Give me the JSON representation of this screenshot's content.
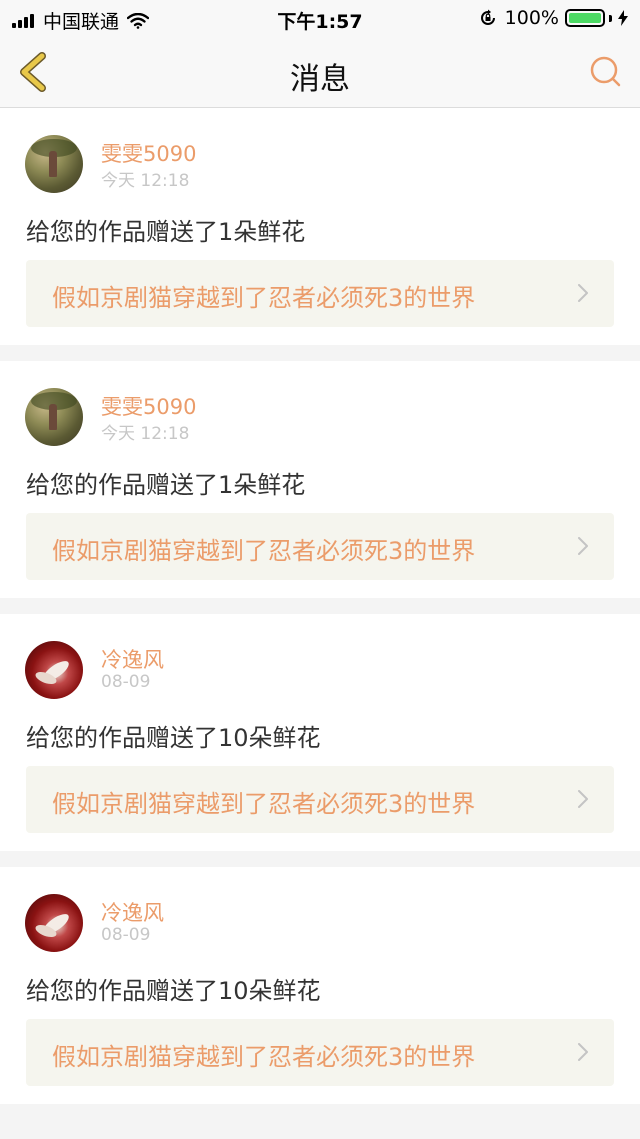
{
  "status_bar": {
    "carrier": "中国联通",
    "time": "下午1:57",
    "battery": "100%",
    "battery_level": 1.0
  },
  "nav": {
    "title": "消息",
    "back_icon": "chevron-left-icon",
    "search_icon": "search-icon"
  },
  "colors": {
    "accent": "#eb9c6a",
    "back_icon": "#e8c84a",
    "battery": "#4cd964"
  },
  "messages": [
    {
      "user": "雯雯5090",
      "time": "今天 12:18",
      "text": "给您的作品赠送了1朵鲜花",
      "work": "假如京剧猫穿越到了忍者必须死3的世界",
      "avatar": "park-photo"
    },
    {
      "user": "雯雯5090",
      "time": "今天 12:18",
      "text": "给您的作品赠送了1朵鲜花",
      "work": "假如京剧猫穿越到了忍者必须死3的世界",
      "avatar": "park-photo"
    },
    {
      "user": "冷逸风",
      "time": "08-09",
      "text": "给您的作品赠送了10朵鲜花",
      "work": "假如京剧猫穿越到了忍者必须死3的世界",
      "avatar": "flower-image"
    },
    {
      "user": "冷逸风",
      "time": "08-09",
      "text": "给您的作品赠送了10朵鲜花",
      "work": "假如京剧猫穿越到了忍者必须死3的世界",
      "avatar": "flower-image"
    }
  ]
}
